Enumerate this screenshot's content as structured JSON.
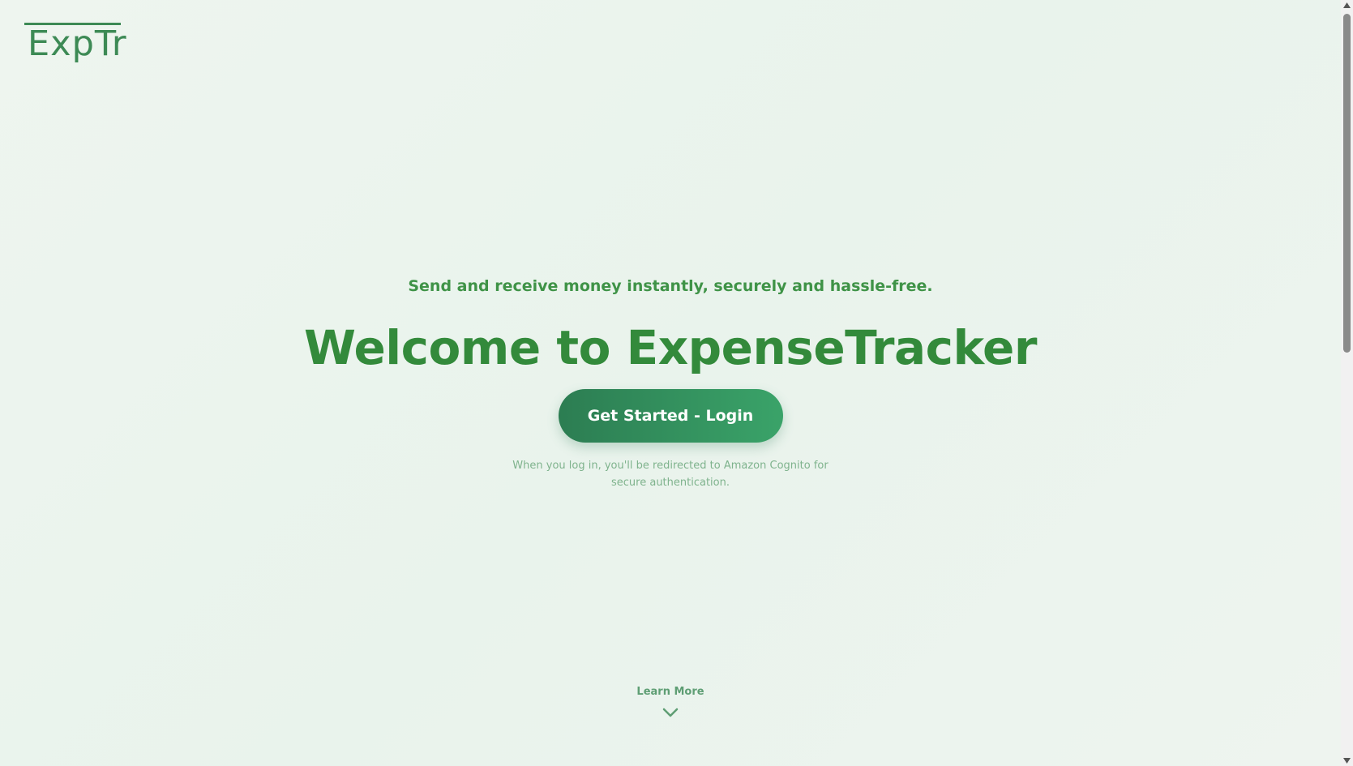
{
  "logo": {
    "text": "ExpTr"
  },
  "hero": {
    "tagline": "Send and receive money instantly, securely and hassle-free.",
    "headline": "Welcome to ExpenseTracker",
    "cta_label": "Get Started - Login",
    "note": "When you log in, you'll be redirected to Amazon Cognito for secure authentication."
  },
  "learn_more": {
    "label": "Learn More",
    "icon": "chevron-down-icon"
  },
  "colors": {
    "brand_green": "#338a3b",
    "button_start": "#2c7d52",
    "button_end": "#3aa369",
    "logo_green": "#3d8a55"
  }
}
